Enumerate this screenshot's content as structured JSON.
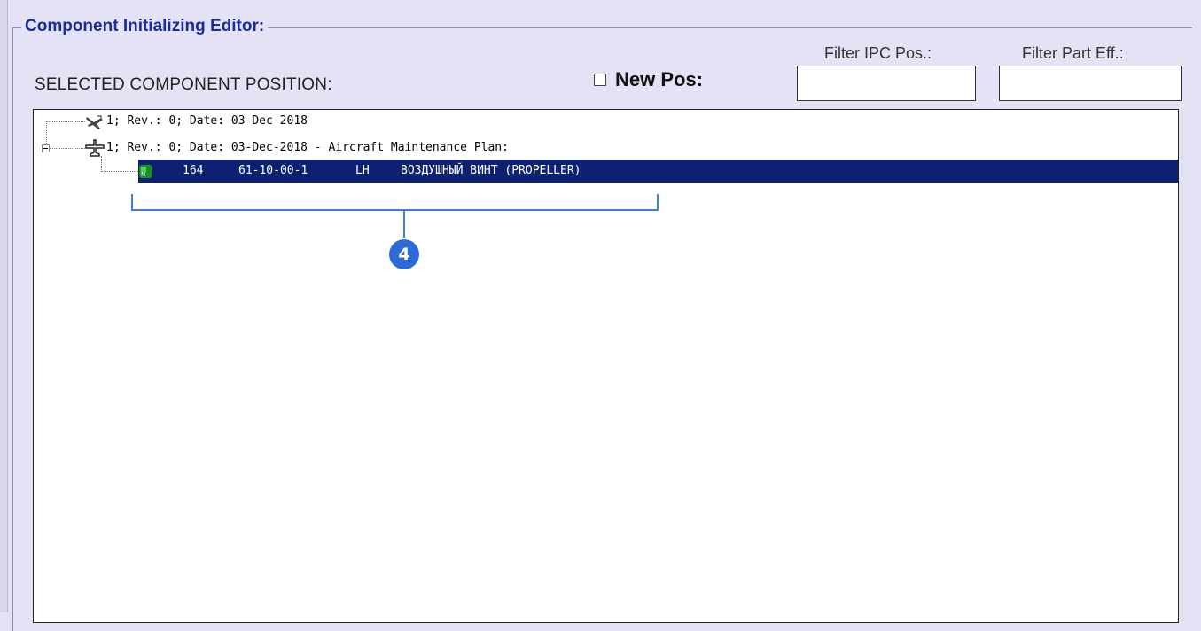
{
  "group": {
    "title": "Component Initializing Editor:"
  },
  "selected_label": "SELECTED COMPONENT POSITION:",
  "new_pos": {
    "label": "New Pos:",
    "checked": false
  },
  "filters": {
    "ipc_label": "Filter IPC Pos.:",
    "ipc_value": "",
    "part_label": "Filter Part Eff.:",
    "part_value": ""
  },
  "tree": {
    "rows": [
      {
        "icon": "aircraft-icon",
        "text": "1; Rev.: 0; Date: 03-Dec-2018"
      },
      {
        "icon": "aircraft-plan-icon",
        "text": "1; Rev.: 0; Date: 03-Dec-2018 - Aircraft Maintenance Plan:",
        "expanded": true
      },
      {
        "icon": "component-icon",
        "selected": true,
        "pos": "164",
        "ata": "61-10-00-1",
        "side": "LH",
        "name": "ВОЗДУШНЫЙ ВИНТ (PROPELLER)"
      }
    ]
  },
  "callout": {
    "number": "4",
    "color": "#2d6ad8"
  },
  "colors": {
    "selection": "#0c2270",
    "title": "#1a2c9c",
    "background": "#e4e3f5"
  }
}
